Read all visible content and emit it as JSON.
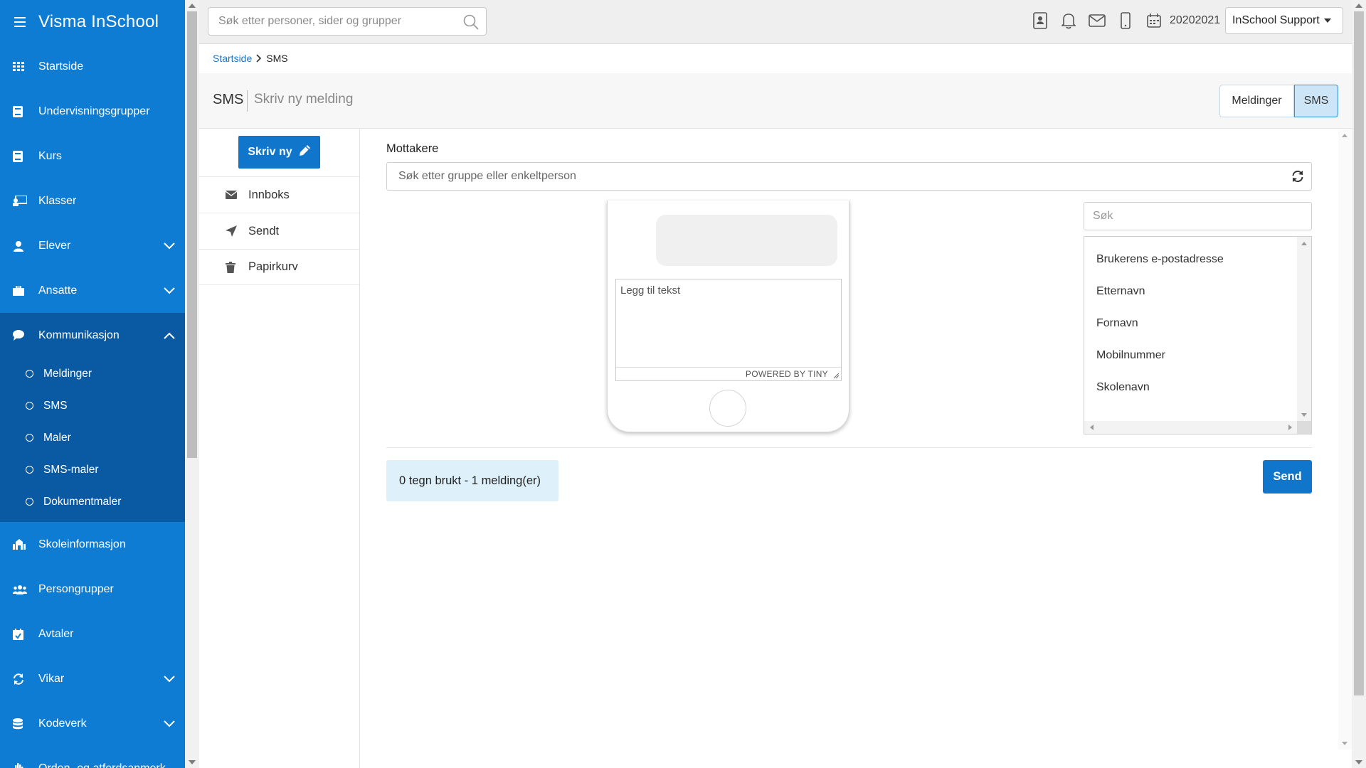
{
  "app": {
    "title": "Visma InSchool"
  },
  "sidebar": {
    "items": [
      {
        "label": "Startside",
        "icon": "grid-icon"
      },
      {
        "label": "Undervisningsgrupper",
        "icon": "book-icon"
      },
      {
        "label": "Kurs",
        "icon": "book-icon"
      },
      {
        "label": "Klasser",
        "icon": "chalkboard-icon"
      },
      {
        "label": "Elever",
        "icon": "student-icon",
        "expandable": true
      },
      {
        "label": "Ansatte",
        "icon": "briefcase-icon",
        "expandable": true
      },
      {
        "label": "Kommunikasjon",
        "icon": "chat-icon",
        "expanded": true
      },
      {
        "label": "Skoleinformasjon",
        "icon": "school-icon"
      },
      {
        "label": "Persongrupper",
        "icon": "users-icon"
      },
      {
        "label": "Avtaler",
        "icon": "calendar-check-icon"
      },
      {
        "label": "Vikar",
        "icon": "sync-icon",
        "expandable": true
      },
      {
        "label": "Kodeverk",
        "icon": "database-icon",
        "expandable": true
      },
      {
        "label": "Orden- og atferdsanmerk",
        "icon": "hand-icon"
      }
    ],
    "sub_items": [
      "Meldinger",
      "SMS",
      "Maler",
      "SMS-maler",
      "Dokumentmaler"
    ]
  },
  "topbar": {
    "search_placeholder": "Søk etter personer, sider og grupper",
    "school_year": "20202021",
    "user_menu_label": "InSchool Support"
  },
  "breadcrumb": {
    "home": "Startside",
    "current": "SMS"
  },
  "page_header": {
    "title": "SMS",
    "subtitle": "Skriv ny melding",
    "toggle_messages": "Meldinger",
    "toggle_sms": "SMS"
  },
  "mail_nav": {
    "compose_label": "Skriv ny",
    "items": [
      {
        "label": "Innboks",
        "icon": "envelope-icon"
      },
      {
        "label": "Sendt",
        "icon": "paper-plane-icon"
      },
      {
        "label": "Papirkurv",
        "icon": "trash-icon"
      }
    ]
  },
  "composer": {
    "recipients_label": "Mottakere",
    "recipients_placeholder": "Søk etter gruppe eller enkeltperson",
    "editor_placeholder": "Legg til tekst",
    "editor_brand": "POWERED BY TINY",
    "field_search_placeholder": "Søk",
    "merge_fields": [
      "Brukerens e-postadresse",
      "Etternavn",
      "Fornavn",
      "Mobilnummer",
      "Skolenavn"
    ],
    "counter_text": "0 tegn brukt - 1 melding(er)",
    "send_label": "Send"
  },
  "colors": {
    "sidebar": "#0f7cd4",
    "sidebar_active": "#0a5aa3",
    "primary_button": "#0f76cc",
    "counter_bg": "#def1fb"
  }
}
